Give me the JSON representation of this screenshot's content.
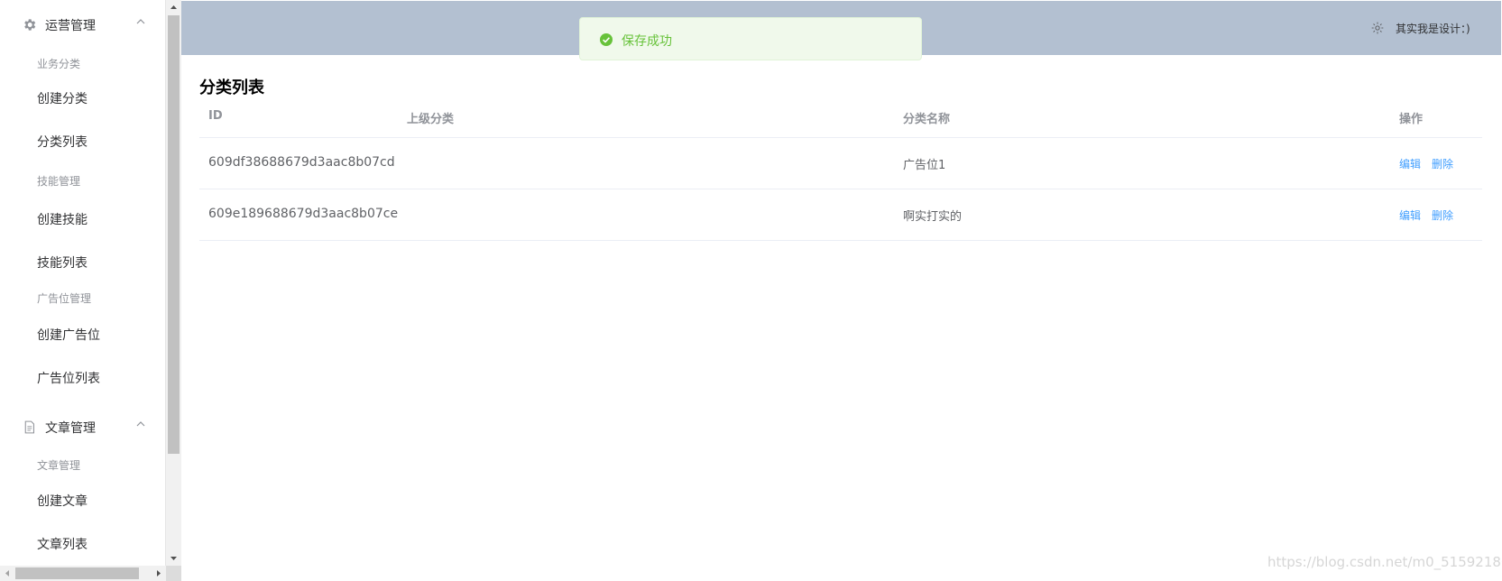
{
  "sidebar": {
    "group1": {
      "title": "运营管理",
      "icon": "gear-icon"
    },
    "group1_sections": [
      {
        "heading": "业务分类",
        "items": [
          "创建分类",
          "分类列表"
        ]
      },
      {
        "heading": "技能管理",
        "items": [
          "创建技能",
          "技能列表"
        ]
      },
      {
        "heading": "广告位管理",
        "items": [
          "创建广告位",
          "广告位列表"
        ]
      }
    ],
    "group2": {
      "title": "文章管理",
      "icon": "document-icon"
    },
    "group2_sections": [
      {
        "heading": "文章管理",
        "items": [
          "创建文章",
          "文章列表"
        ]
      }
    ]
  },
  "header": {
    "user_text": "其实我是设计：)",
    "settings_icon": "gear-icon"
  },
  "toast": {
    "message": "保存成功",
    "icon": "check-circle-icon",
    "color": "#67c23a"
  },
  "page": {
    "title": "分类列表",
    "columns": [
      "ID",
      "上级分类",
      "分类名称",
      "操作"
    ],
    "rows": [
      {
        "id": "609df38688679d3aac8b07cd",
        "parent": "",
        "name": "广告位1",
        "edit": "编辑",
        "delete": "删除"
      },
      {
        "id": "609e189688679d3aac8b07ce",
        "parent": "",
        "name": "啊实打实的",
        "edit": "编辑",
        "delete": "删除"
      }
    ]
  },
  "watermark": "https://blog.csdn.net/m0_51592186",
  "colors": {
    "header_bg": "#b3c0d1",
    "link": "#409eff",
    "toast_bg": "#f0f9eb"
  }
}
